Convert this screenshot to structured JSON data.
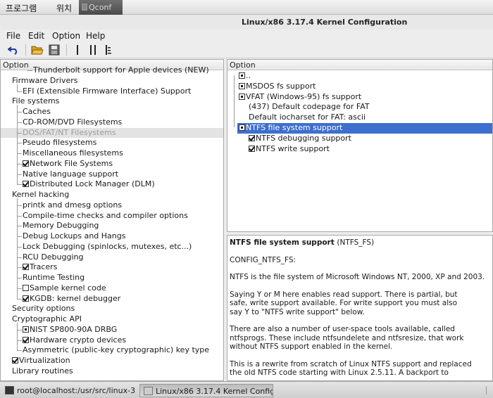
{
  "top_panel": {
    "applications": "프로그램",
    "places": "위치",
    "task_qconf": "Qconf"
  },
  "window": {
    "title": "Linux/x86 3.17.4 Kernel Configuration"
  },
  "menubar": {
    "file": "File",
    "edit": "Edit",
    "option": "Option",
    "help": "Help"
  },
  "toolbar": {
    "icons": [
      "undo-icon",
      "open-folder-icon",
      "save-icon",
      "single-view-icon",
      "split-view-icon",
      "full-view-icon"
    ]
  },
  "left_pane": {
    "header": "Option",
    "rows": [
      {
        "label": "Thunderbolt support for Apple devices (NEW)",
        "level": 2,
        "check": "none"
      },
      {
        "label": "Firmware Drivers",
        "level": 0,
        "check": "none"
      },
      {
        "label": "EFI (Extensible Firmware Interface) Support",
        "level": 1,
        "check": "none"
      },
      {
        "label": "File systems",
        "level": 0,
        "check": "none"
      },
      {
        "label": "Caches",
        "level": 1,
        "check": "none"
      },
      {
        "label": "CD-ROM/DVD Filesystems",
        "level": 1,
        "check": "none"
      },
      {
        "label": "DOS/FAT/NT Filesystems",
        "level": 1,
        "check": "none",
        "selected": true
      },
      {
        "label": "Pseudo filesystems",
        "level": 1,
        "check": "none"
      },
      {
        "label": "Miscellaneous filesystems",
        "level": 1,
        "check": "none"
      },
      {
        "label": "Network File Systems",
        "level": 1,
        "check": "checked"
      },
      {
        "label": "Native language support",
        "level": 1,
        "check": "none"
      },
      {
        "label": "Distributed Lock Manager (DLM)",
        "level": 1,
        "check": "checked"
      },
      {
        "label": "Kernel hacking",
        "level": 0,
        "check": "none"
      },
      {
        "label": "printk and dmesg options",
        "level": 1,
        "check": "none"
      },
      {
        "label": "Compile-time checks and compiler options",
        "level": 1,
        "check": "none"
      },
      {
        "label": "Memory Debugging",
        "level": 1,
        "check": "none"
      },
      {
        "label": "Debug Lockups and Hangs",
        "level": 1,
        "check": "none"
      },
      {
        "label": "Lock Debugging (spinlocks, mutexes, etc...)",
        "level": 1,
        "check": "none"
      },
      {
        "label": "RCU Debugging",
        "level": 1,
        "check": "none"
      },
      {
        "label": "Tracers",
        "level": 1,
        "check": "checked"
      },
      {
        "label": "Runtime Testing",
        "level": 1,
        "check": "none"
      },
      {
        "label": "Sample kernel code",
        "level": 1,
        "check": "empty"
      },
      {
        "label": "KGDB: kernel debugger",
        "level": 1,
        "check": "checked"
      },
      {
        "label": "Security options",
        "level": 0,
        "check": "none"
      },
      {
        "label": "Cryptographic API",
        "level": 0,
        "check": "none"
      },
      {
        "label": "NIST SP800-90A DRBG",
        "level": 1,
        "check": "dot"
      },
      {
        "label": "Hardware crypto devices",
        "level": 1,
        "check": "checked"
      },
      {
        "label": "Asymmetric (public-key cryptographic) key type",
        "level": 1,
        "check": "none"
      },
      {
        "label": "Virtualization",
        "level": 0,
        "check": "checked"
      },
      {
        "label": "Library routines",
        "level": 0,
        "check": "none"
      }
    ]
  },
  "right_pane": {
    "header": "Option",
    "rows": [
      {
        "label": "..",
        "level": 0,
        "check": "dot"
      },
      {
        "label": "MSDOS fs support",
        "level": 0,
        "check": "dot"
      },
      {
        "label": "VFAT (Windows-95) fs support",
        "level": 0,
        "check": "dot"
      },
      {
        "label": "(437) Default codepage for FAT",
        "level": 1,
        "check": "none"
      },
      {
        "label": "Default iocharset for FAT: ascii",
        "level": 1,
        "check": "none"
      },
      {
        "label": "NTFS file system support",
        "level": 0,
        "check": "dot",
        "selected": true
      },
      {
        "label": "NTFS debugging support",
        "level": 1,
        "check": "checked"
      },
      {
        "label": "NTFS write support",
        "level": 1,
        "check": "checked"
      }
    ]
  },
  "help": {
    "title": "NTFS file system support",
    "symbol": "(NTFS_FS)",
    "config": "CONFIG_NTFS_FS:",
    "p1": "NTFS is the file system of Microsoft Windows NT, 2000, XP and 2003.",
    "p2": "Saying Y or M here enables read support. There is partial, but\nsafe, write support available. For write support you must also\nsay Y to \"NTFS write support\" below.",
    "p3": "There are also a number of user-space tools available, called\nntfsprogs. These include ntfsundelete and ntfsresize, that work\nwithout NTFS support enabled in the kernel.",
    "p4": "This is a rewrite from scratch of Linux NTFS support and replaced\nthe old NTFS code starting with Linux 2.5.11. A backport to"
  },
  "taskbar": {
    "terminal": "root@localhost:/usr/src/linux-3...",
    "kernel_config": "Linux/x86 3.17.4 Kernel Configu..."
  },
  "colors": {
    "selection_blue": "#3d6fce",
    "selection_gray": "#e3e3e3"
  }
}
